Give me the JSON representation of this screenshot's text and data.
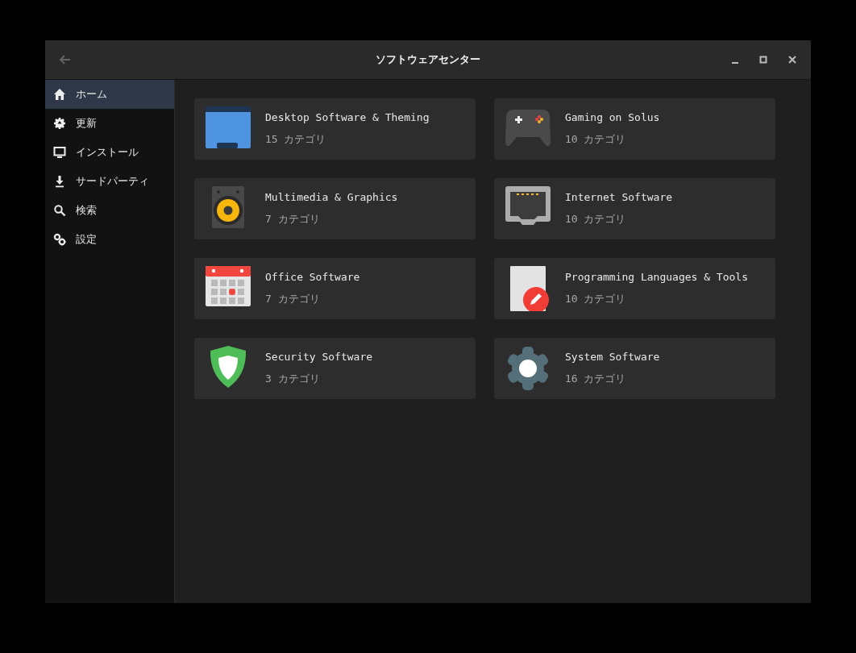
{
  "window": {
    "title": "ソフトウェアセンター"
  },
  "sidebar": {
    "items": [
      {
        "label": "ホーム",
        "kind": "home",
        "selected": true
      },
      {
        "label": "更新",
        "kind": "update",
        "selected": false
      },
      {
        "label": "インストール",
        "kind": "monitor",
        "selected": false
      },
      {
        "label": "サードパーティ",
        "kind": "download",
        "selected": false
      },
      {
        "label": "検索",
        "kind": "search",
        "selected": false
      },
      {
        "label": "設定",
        "kind": "settings",
        "selected": false
      }
    ]
  },
  "categories": [
    {
      "name": "Desktop Software & Theming",
      "count": "15 カテゴリ",
      "kind": "desktop"
    },
    {
      "name": "Gaming on Solus",
      "count": "10 カテゴリ",
      "kind": "gaming"
    },
    {
      "name": "Multimedia & Graphics",
      "count": "7 カテゴリ",
      "kind": "multimedia"
    },
    {
      "name": "Internet Software",
      "count": "10 カテゴリ",
      "kind": "internet"
    },
    {
      "name": "Office Software",
      "count": "7 カテゴリ",
      "kind": "office"
    },
    {
      "name": "Programming Languages & Tools",
      "count": "10 カテゴリ",
      "kind": "programming"
    },
    {
      "name": "Security Software",
      "count": "3 カテゴリ",
      "kind": "security"
    },
    {
      "name": "System Software",
      "count": "16 カテゴリ",
      "kind": "system"
    }
  ]
}
